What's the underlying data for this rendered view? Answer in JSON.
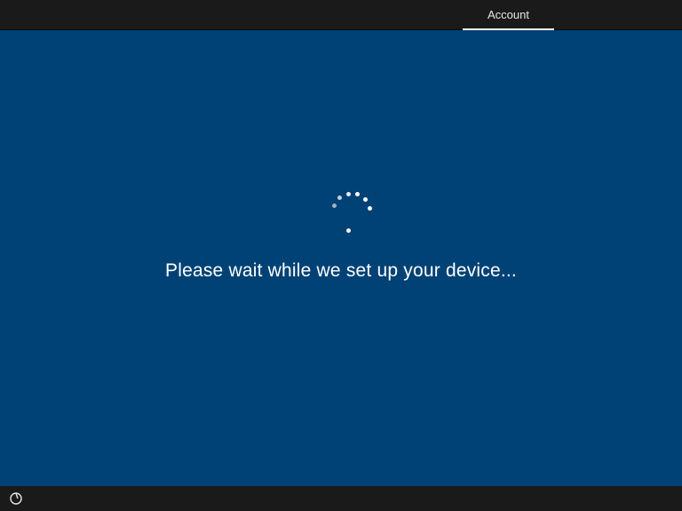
{
  "header": {
    "tab_label": "Account"
  },
  "main": {
    "status_message": "Please wait while we set up your device..."
  },
  "footer": {
    "ease_of_access_icon": "ease-of-access-icon"
  },
  "colors": {
    "background": "#004275",
    "bar": "#1a1a1a",
    "text": "#ffffff"
  }
}
